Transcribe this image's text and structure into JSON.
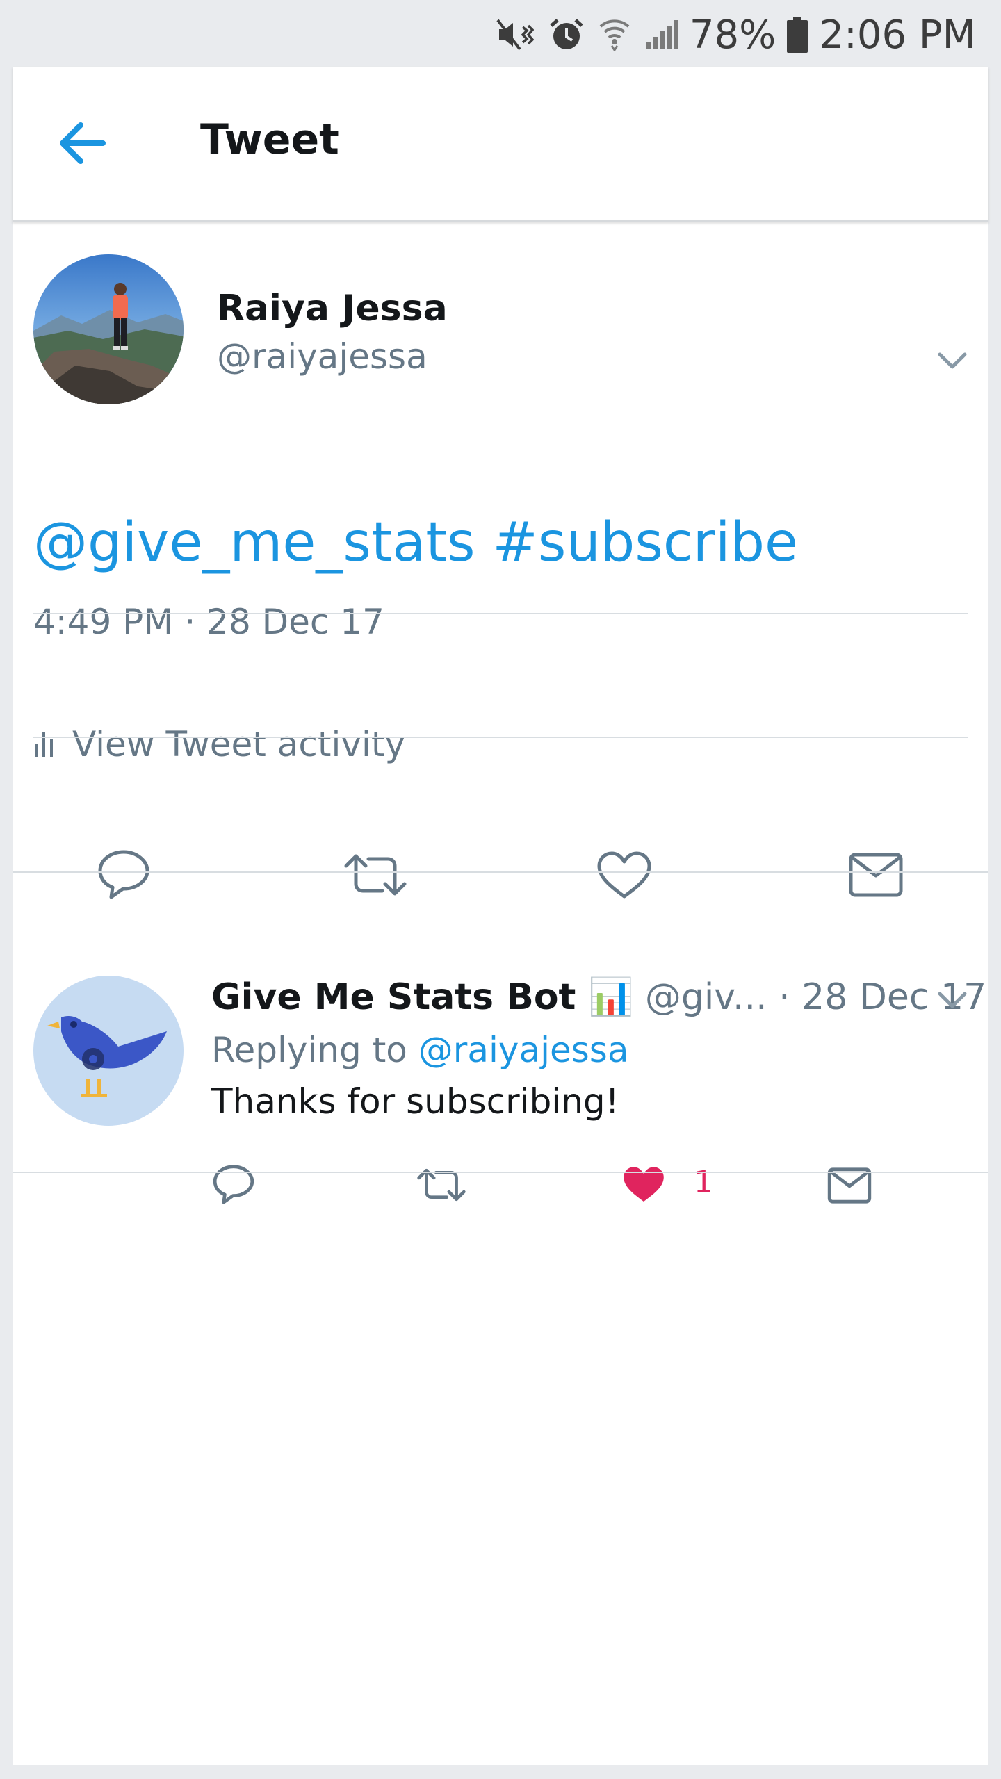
{
  "status_bar": {
    "battery_percent": "78%",
    "time": "2:06 PM",
    "icons": [
      "mute-vibrate-icon",
      "alarm-icon",
      "wifi-icon",
      "signal-icon",
      "battery-icon"
    ]
  },
  "header": {
    "title": "Tweet",
    "back_icon": "arrow-left-icon"
  },
  "tweet": {
    "author_name": "Raiya Jessa",
    "author_handle": "@raiyajessa",
    "mention": "@give_me_stats",
    "hashtag": "#subscribe",
    "timestamp": "4:49 PM · 28 Dec 17",
    "activity_label": "View Tweet activity",
    "actions": [
      "reply-icon",
      "retweet-icon",
      "like-icon",
      "direct-message-icon"
    ]
  },
  "reply": {
    "author_name": "Give Me Stats Bot 📊",
    "author_handle": "@giv...",
    "date": " · 28 Dec 17",
    "replying_prefix": "Replying to ",
    "replying_to": "@raiyajessa",
    "text": "Thanks for subscribing!",
    "like_count": "1",
    "liked": true
  },
  "colors": {
    "accent_blue": "#1b95e0",
    "secondary_text": "#657786",
    "like_red": "#e0245e",
    "background": "#e9ebee"
  }
}
